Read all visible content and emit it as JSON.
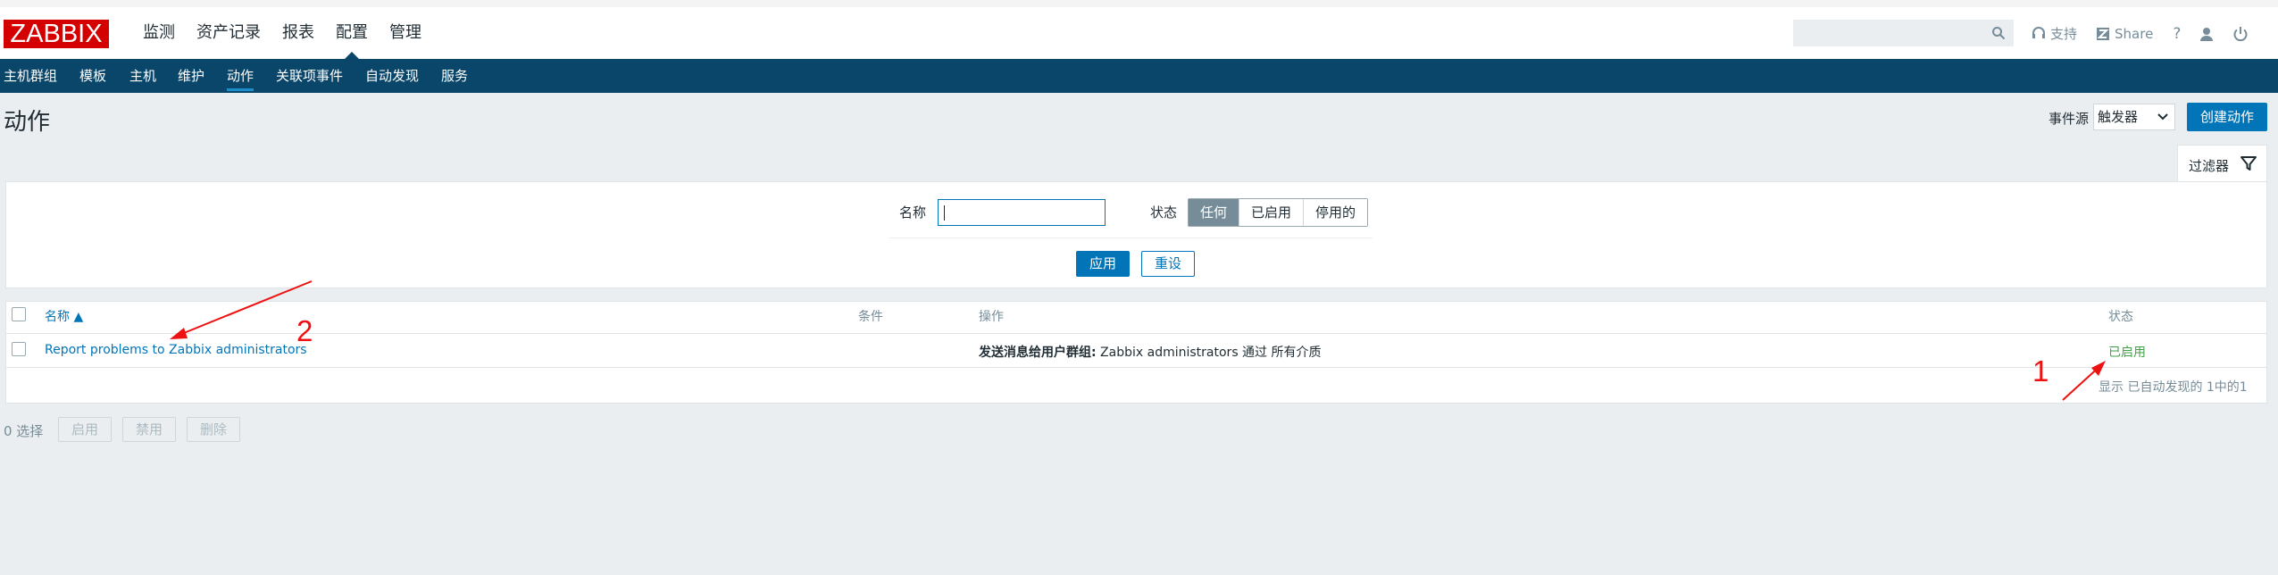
{
  "brand": {
    "logo": "ZABBIX",
    "logo_color": "#d40000"
  },
  "main_nav": [
    "监测",
    "资产记录",
    "报表",
    "配置",
    "管理"
  ],
  "main_nav_active": "配置",
  "top_right": {
    "support": "支持",
    "share": "Share",
    "help": "?"
  },
  "sub_nav": [
    "主机群组",
    "模板",
    "主机",
    "维护",
    "动作",
    "关联项事件",
    "自动发现",
    "服务"
  ],
  "sub_nav_active": "动作",
  "page": {
    "title": "动作",
    "event_source_label": "事件源",
    "event_source_value": "触发器",
    "create_button": "创建动作"
  },
  "filter": {
    "tab_label": "过滤器",
    "name_label": "名称",
    "name_value": "",
    "status_label": "状态",
    "status_options": [
      "任何",
      "已启用",
      "停用的"
    ],
    "status_selected": "任何",
    "apply": "应用",
    "reset": "重设"
  },
  "table": {
    "headers": {
      "name": "名称 ▲",
      "conditions": "条件",
      "operations": "操作",
      "status": "状态"
    },
    "rows": [
      {
        "name": "Report problems to Zabbix administrators",
        "conditions": "",
        "operations_bold": "发送消息给用户群组:",
        "operations_rest": " Zabbix administrators 通过 所有介质",
        "status": "已启用"
      }
    ],
    "footer": "显示 已自动发现的 1中的1"
  },
  "bottom": {
    "selected": "0 选择",
    "buttons": [
      "启用",
      "禁用",
      "删除"
    ]
  },
  "annotations": {
    "one": "1",
    "two": "2"
  },
  "colors": {
    "nav_bg": "#0a466a",
    "primary": "#0275b8",
    "enabled": "#429e47",
    "annotation": "#ee1111"
  }
}
